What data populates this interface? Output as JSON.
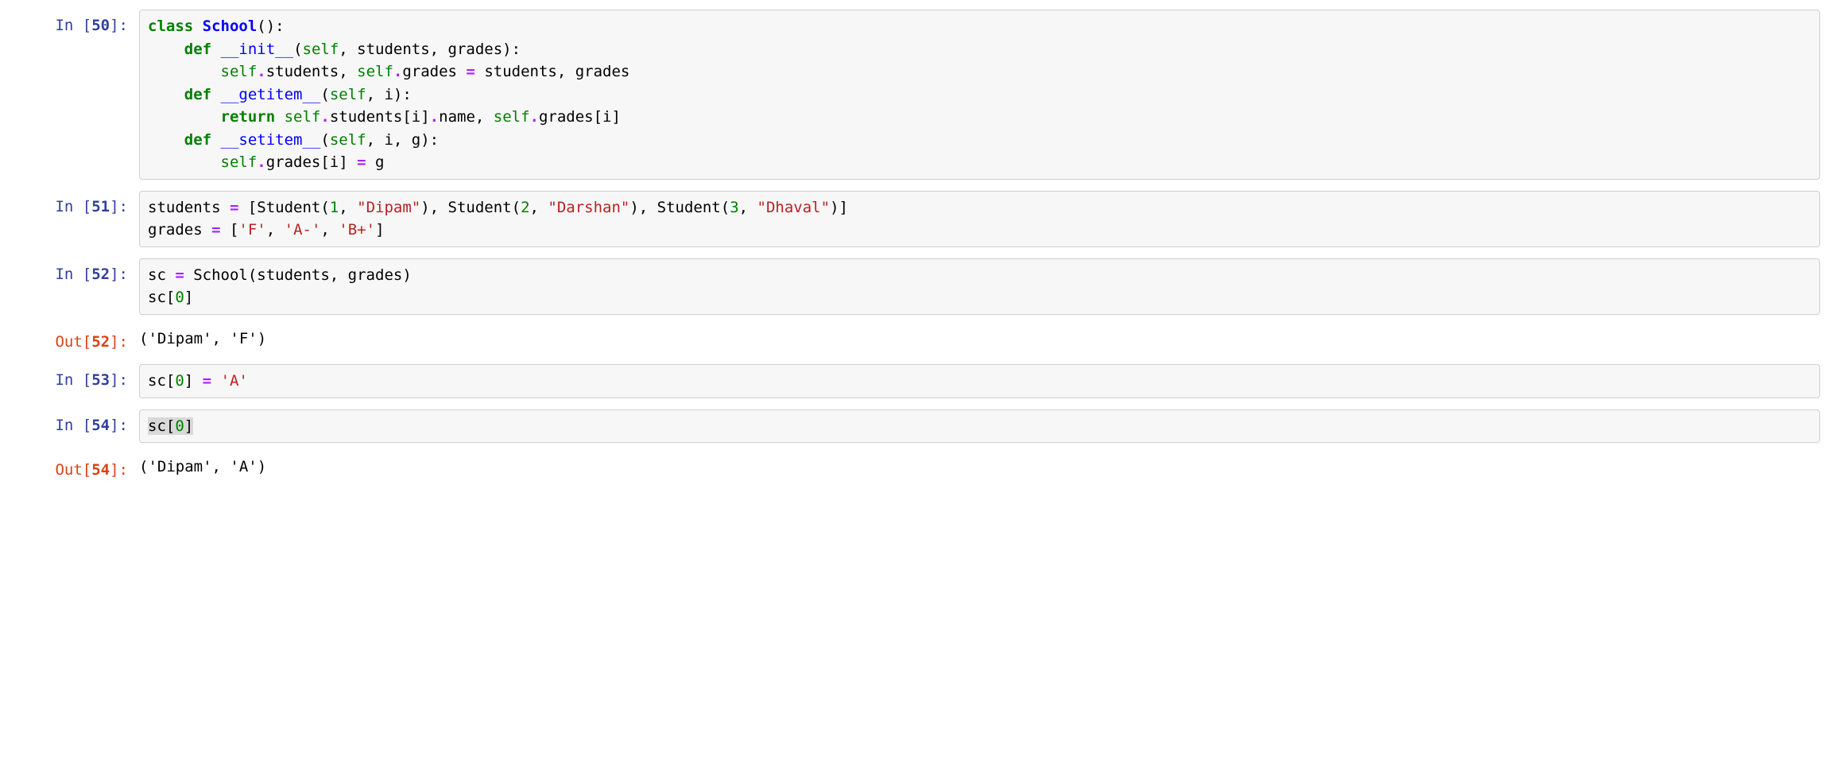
{
  "cells": [
    {
      "in_prompt": {
        "label": "In ",
        "open": "[",
        "num": "50",
        "close": "]:"
      },
      "code_tokens": [
        {
          "c": "kw",
          "t": "class"
        },
        {
          "c": "nm",
          "t": " "
        },
        {
          "c": "cls",
          "t": "School"
        },
        {
          "c": "pun",
          "t": "():"
        },
        {
          "c": "nm",
          "t": "\n    "
        },
        {
          "c": "kw",
          "t": "def"
        },
        {
          "c": "nm",
          "t": " "
        },
        {
          "c": "fn",
          "t": "__init__"
        },
        {
          "c": "pun",
          "t": "("
        },
        {
          "c": "pseudo",
          "t": "self"
        },
        {
          "c": "pun",
          "t": ", students, grades):"
        },
        {
          "c": "nm",
          "t": "\n        "
        },
        {
          "c": "pseudo",
          "t": "self"
        },
        {
          "c": "op",
          "t": "."
        },
        {
          "c": "nm",
          "t": "students, "
        },
        {
          "c": "pseudo",
          "t": "self"
        },
        {
          "c": "op",
          "t": "."
        },
        {
          "c": "nm",
          "t": "grades "
        },
        {
          "c": "op",
          "t": "="
        },
        {
          "c": "nm",
          "t": " students, grades\n    "
        },
        {
          "c": "kw",
          "t": "def"
        },
        {
          "c": "nm",
          "t": " "
        },
        {
          "c": "fn",
          "t": "__getitem__"
        },
        {
          "c": "pun",
          "t": "("
        },
        {
          "c": "pseudo",
          "t": "self"
        },
        {
          "c": "pun",
          "t": ", i):"
        },
        {
          "c": "nm",
          "t": "\n        "
        },
        {
          "c": "kw",
          "t": "return"
        },
        {
          "c": "nm",
          "t": " "
        },
        {
          "c": "pseudo",
          "t": "self"
        },
        {
          "c": "op",
          "t": "."
        },
        {
          "c": "nm",
          "t": "students[i]"
        },
        {
          "c": "op",
          "t": "."
        },
        {
          "c": "nm",
          "t": "name, "
        },
        {
          "c": "pseudo",
          "t": "self"
        },
        {
          "c": "op",
          "t": "."
        },
        {
          "c": "nm",
          "t": "grades[i]\n    "
        },
        {
          "c": "kw",
          "t": "def"
        },
        {
          "c": "nm",
          "t": " "
        },
        {
          "c": "fn",
          "t": "__setitem__"
        },
        {
          "c": "pun",
          "t": "("
        },
        {
          "c": "pseudo",
          "t": "self"
        },
        {
          "c": "pun",
          "t": ", i, g):"
        },
        {
          "c": "nm",
          "t": "\n        "
        },
        {
          "c": "pseudo",
          "t": "self"
        },
        {
          "c": "op",
          "t": "."
        },
        {
          "c": "nm",
          "t": "grades[i] "
        },
        {
          "c": "op",
          "t": "="
        },
        {
          "c": "nm",
          "t": " g"
        }
      ]
    },
    {
      "in_prompt": {
        "label": "In ",
        "open": "[",
        "num": "51",
        "close": "]:"
      },
      "code_tokens": [
        {
          "c": "nm",
          "t": "students "
        },
        {
          "c": "op",
          "t": "="
        },
        {
          "c": "nm",
          "t": " [Student("
        },
        {
          "c": "int",
          "t": "1"
        },
        {
          "c": "nm",
          "t": ", "
        },
        {
          "c": "str",
          "t": "\"Dipam\""
        },
        {
          "c": "nm",
          "t": "), Student("
        },
        {
          "c": "int",
          "t": "2"
        },
        {
          "c": "nm",
          "t": ", "
        },
        {
          "c": "str",
          "t": "\"Darshan\""
        },
        {
          "c": "nm",
          "t": "), Student("
        },
        {
          "c": "int",
          "t": "3"
        },
        {
          "c": "nm",
          "t": ", "
        },
        {
          "c": "str",
          "t": "\"Dhaval\""
        },
        {
          "c": "nm",
          "t": ")]\n"
        },
        {
          "c": "nm",
          "t": "grades "
        },
        {
          "c": "op",
          "t": "="
        },
        {
          "c": "nm",
          "t": " ["
        },
        {
          "c": "str",
          "t": "'F'"
        },
        {
          "c": "nm",
          "t": ", "
        },
        {
          "c": "str",
          "t": "'A-'"
        },
        {
          "c": "nm",
          "t": ", "
        },
        {
          "c": "str",
          "t": "'B+'"
        },
        {
          "c": "nm",
          "t": "]"
        }
      ]
    },
    {
      "in_prompt": {
        "label": "In ",
        "open": "[",
        "num": "52",
        "close": "]:"
      },
      "code_tokens": [
        {
          "c": "nm",
          "t": "sc "
        },
        {
          "c": "op",
          "t": "="
        },
        {
          "c": "nm",
          "t": " School(students, grades)\nsc["
        },
        {
          "c": "int",
          "t": "0"
        },
        {
          "c": "nm",
          "t": "]"
        }
      ],
      "out_prompt": {
        "label": "Out",
        "open": "[",
        "num": "52",
        "close": "]:"
      },
      "output": "('Dipam', 'F')"
    },
    {
      "in_prompt": {
        "label": "In ",
        "open": "[",
        "num": "53",
        "close": "]:"
      },
      "code_tokens": [
        {
          "c": "nm",
          "t": "sc["
        },
        {
          "c": "int",
          "t": "0"
        },
        {
          "c": "nm",
          "t": "] "
        },
        {
          "c": "op",
          "t": "="
        },
        {
          "c": "nm",
          "t": " "
        },
        {
          "c": "str",
          "t": "'A'"
        }
      ]
    },
    {
      "in_prompt": {
        "label": "In ",
        "open": "[",
        "num": "54",
        "close": "]:"
      },
      "code_tokens": [
        {
          "c": "nm",
          "t": "sc[",
          "hl": true
        },
        {
          "c": "int",
          "t": "0",
          "hl": true
        },
        {
          "c": "nm",
          "t": "]",
          "hl": true
        }
      ],
      "out_prompt": {
        "label": "Out",
        "open": "[",
        "num": "54",
        "close": "]:"
      },
      "output": "('Dipam', 'A')"
    }
  ]
}
